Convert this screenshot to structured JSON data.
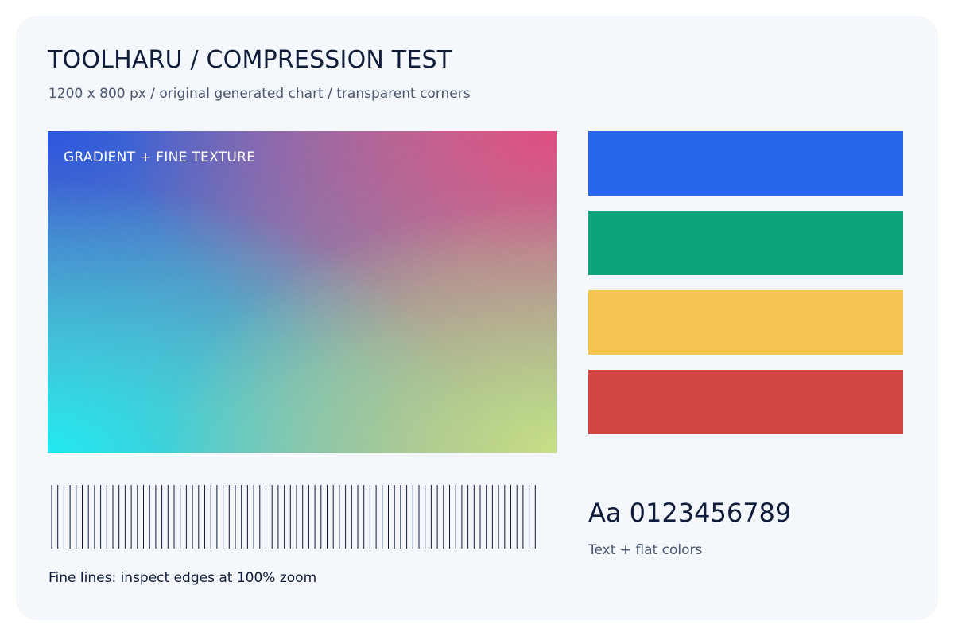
{
  "header": {
    "title": "TOOLHARU / COMPRESSION TEST",
    "subtitle": "1200 x 800 px / original generated chart / transparent corners"
  },
  "gradient_panel": {
    "label": "GRADIENT + FINE TEXTURE",
    "colors": {
      "top_left": "#2850dc",
      "top_right": "#de4878",
      "bottom_left": "#1ee6f0",
      "bottom_right": "#c6e278"
    }
  },
  "swatches": [
    {
      "name": "blue",
      "color": "#2866ea"
    },
    {
      "name": "green",
      "color": "#0fa37b"
    },
    {
      "name": "yellow",
      "color": "#f6c453"
    },
    {
      "name": "red",
      "color": "#d24545"
    }
  ],
  "fine_lines": {
    "count": 80,
    "color": "#0f1d3a",
    "caption": "Fine lines: inspect edges at 100% zoom"
  },
  "type_sample": {
    "text": "Aa 0123456789",
    "caption": "Text + flat colors"
  }
}
